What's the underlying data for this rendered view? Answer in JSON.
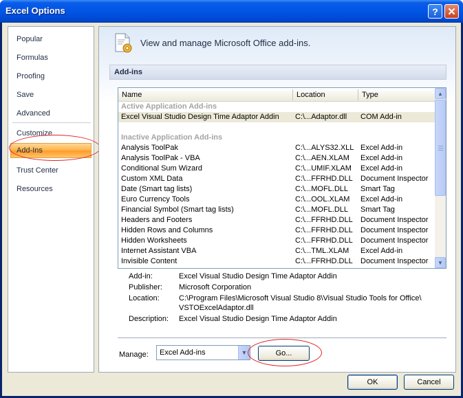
{
  "window": {
    "title": "Excel Options",
    "help_label": "?",
    "close_label": "✕"
  },
  "sidebar": {
    "items": [
      {
        "label": "Popular"
      },
      {
        "label": "Formulas"
      },
      {
        "label": "Proofing"
      },
      {
        "label": "Save"
      },
      {
        "label": "Advanced"
      },
      {
        "label": "Customize"
      },
      {
        "label": "Add-Ins"
      },
      {
        "label": "Trust Center"
      },
      {
        "label": "Resources"
      }
    ],
    "selected": "Add-Ins"
  },
  "main": {
    "header_icon": "gear-document-icon",
    "header_text": "View and manage Microsoft Office add-ins.",
    "section_title": "Add-ins"
  },
  "list": {
    "columns": [
      "Name",
      "Location",
      "Type"
    ],
    "rows": [
      {
        "kind": "group",
        "name": "Active Application Add-ins",
        "location": "",
        "type": ""
      },
      {
        "kind": "item",
        "name": "Excel Visual Studio Design Time Adaptor Addin",
        "location": "C:\\...Adaptor.dll",
        "type": "COM Add-in",
        "selected": true
      },
      {
        "kind": "blank",
        "name": "",
        "location": "",
        "type": ""
      },
      {
        "kind": "group",
        "name": "Inactive Application Add-ins",
        "location": "",
        "type": ""
      },
      {
        "kind": "item",
        "name": "Analysis ToolPak",
        "location": "C:\\...ALYS32.XLL",
        "type": "Excel Add-in"
      },
      {
        "kind": "item",
        "name": "Analysis ToolPak - VBA",
        "location": "C:\\...AEN.XLAM",
        "type": "Excel Add-in"
      },
      {
        "kind": "item",
        "name": "Conditional Sum Wizard",
        "location": "C:\\...UMIF.XLAM",
        "type": "Excel Add-in"
      },
      {
        "kind": "item",
        "name": "Custom XML Data",
        "location": "C:\\...FFRHD.DLL",
        "type": "Document Inspector"
      },
      {
        "kind": "item",
        "name": "Date (Smart tag lists)",
        "location": "C:\\...MOFL.DLL",
        "type": "Smart Tag"
      },
      {
        "kind": "item",
        "name": "Euro Currency Tools",
        "location": "C:\\...OOL.XLAM",
        "type": "Excel Add-in"
      },
      {
        "kind": "item",
        "name": "Financial Symbol (Smart tag lists)",
        "location": "C:\\...MOFL.DLL",
        "type": "Smart Tag"
      },
      {
        "kind": "item",
        "name": "Headers and Footers",
        "location": "C:\\...FFRHD.DLL",
        "type": "Document Inspector"
      },
      {
        "kind": "item",
        "name": "Hidden Rows and Columns",
        "location": "C:\\...FFRHD.DLL",
        "type": "Document Inspector"
      },
      {
        "kind": "item",
        "name": "Hidden Worksheets",
        "location": "C:\\...FFRHD.DLL",
        "type": "Document Inspector"
      },
      {
        "kind": "item",
        "name": "Internet Assistant VBA",
        "location": "C:\\...TML.XLAM",
        "type": "Excel Add-in"
      },
      {
        "kind": "item",
        "name": "Invisible Content",
        "location": "C:\\...FFRHD.DLL",
        "type": "Document Inspector"
      }
    ]
  },
  "details": {
    "addin_label": "Add-in:",
    "addin_value": "Excel Visual Studio Design Time Adaptor Addin",
    "publisher_label": "Publisher:",
    "publisher_value": "Microsoft Corporation",
    "location_label": "Location:",
    "location_value_line1": "C:\\Program Files\\Microsoft Visual Studio 8\\Visual Studio Tools for Office\\",
    "location_value_line2": "VSTOExcelAdaptor.dll",
    "description_label": "Description:",
    "description_value": "Excel Visual Studio Design Time Adaptor Addin"
  },
  "manage": {
    "label": "Manage:",
    "selected": "Excel Add-ins",
    "go_label": "Go..."
  },
  "footer": {
    "ok_label": "OK",
    "cancel_label": "Cancel"
  },
  "colors": {
    "selected_orange": "#ffb64d",
    "annotation_red": "#e02020",
    "title_blue": "#0055e5"
  }
}
